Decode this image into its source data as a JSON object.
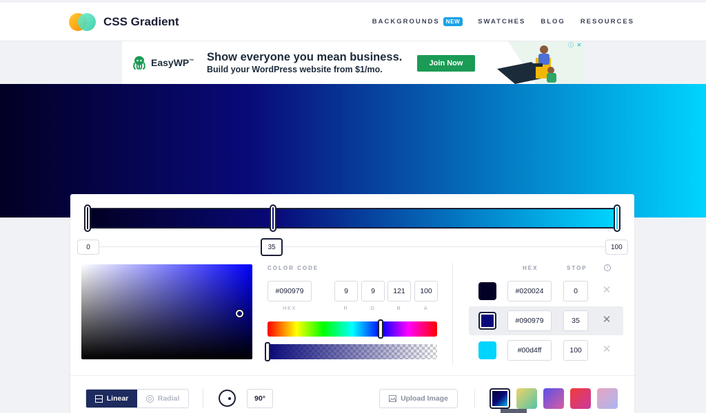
{
  "header": {
    "logo_text": "CSS Gradient",
    "nav": [
      {
        "label": "BACKGROUNDS",
        "badge": "NEW"
      },
      {
        "label": "SWATCHES"
      },
      {
        "label": "BLOG"
      },
      {
        "label": "RESOURCES"
      }
    ]
  },
  "ad": {
    "brand": "EasyWP",
    "brand_mark": "™",
    "headline": "Show everyone you mean business.",
    "subline": "Build your WordPress website from $1/mo.",
    "cta": "Join Now"
  },
  "gradient": {
    "css": "linear-gradient(90deg, rgba(2,0,36,1) 0%, rgba(9,9,121,1) 35%, rgba(0,212,255,1) 100%)",
    "stops": [
      {
        "hex": "#020024",
        "position": "0",
        "color": "#020024"
      },
      {
        "hex": "#090979",
        "position": "35",
        "color": "#090979"
      },
      {
        "hex": "#00d4ff",
        "position": "100",
        "color": "#00d4ff"
      }
    ],
    "selected_stop": 1
  },
  "positions": {
    "p0": "0",
    "p1": "35",
    "p2": "100"
  },
  "picker": {
    "label": "COLOR CODE",
    "hex": "#090979",
    "r": "9",
    "g": "9",
    "b": "121",
    "a": "100",
    "labels": {
      "hex": "HEX",
      "r": "R",
      "g": "G",
      "b": "B",
      "a": "A"
    }
  },
  "stops_table": {
    "col_hex": "HEX",
    "col_stop": "STOP",
    "delete_glyph": "✕"
  },
  "bottom": {
    "linear_label": "Linear",
    "radial_label": "Radial",
    "angle": "90°",
    "upload_label": "Upload Image"
  },
  "presets": [
    {
      "name": "preset-navy-cyan",
      "colors": [
        "#020024",
        "#090979",
        "#00d4ff"
      ]
    },
    {
      "name": "preset-green-yellow",
      "colors": [
        "#eed36a",
        "#55c4a4"
      ]
    },
    {
      "name": "preset-purple",
      "colors": [
        "#5a52e8",
        "#d95ca0"
      ]
    },
    {
      "name": "preset-red-pink",
      "colors": [
        "#f23a3a",
        "#c83aa0"
      ]
    },
    {
      "name": "preset-pastel",
      "colors": [
        "#e9a3c2",
        "#a9b8f0"
      ]
    }
  ],
  "colors": {
    "accent": "#1e2b5e",
    "new_badge": "#1aa1e6",
    "ad_cta": "#1b9b55"
  }
}
